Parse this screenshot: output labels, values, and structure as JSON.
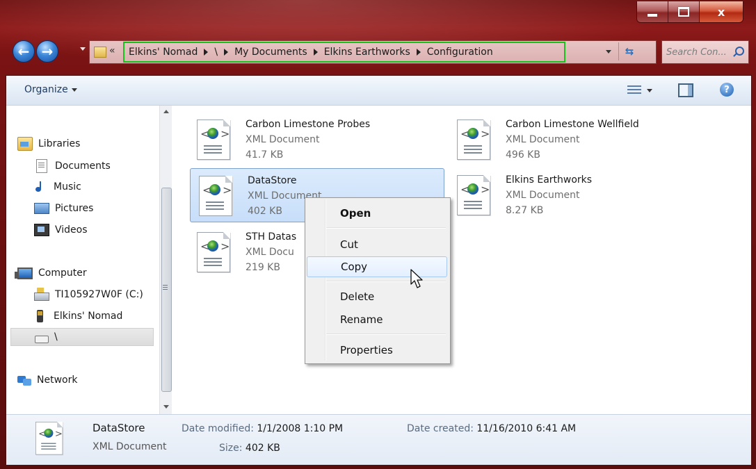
{
  "window": {
    "close_glyph": "x"
  },
  "nav": {
    "back_glyph": "←",
    "forward_glyph": "→",
    "overflow_chevrons": "«",
    "breadcrumbs": [
      "Elkins' Nomad",
      "\\",
      "My Documents",
      "Elkins Earthworks",
      "Configuration"
    ],
    "refresh_glyph": "⇆",
    "search_placeholder": "Search Con...",
    "path_highlight_color": "#19c21a"
  },
  "toolbar": {
    "organize_label": "Organize",
    "help_glyph": "?"
  },
  "sidebar": {
    "items": [
      {
        "label": "Libraries",
        "icon": "libraries-icon"
      },
      {
        "label": "Documents",
        "icon": "documents-icon"
      },
      {
        "label": "Music",
        "icon": "music-icon"
      },
      {
        "label": "Pictures",
        "icon": "pictures-icon"
      },
      {
        "label": "Videos",
        "icon": "videos-icon"
      },
      {
        "label": "Computer",
        "icon": "computer-icon"
      },
      {
        "label": "TI105927W0F (C:)",
        "icon": "drive-icon"
      },
      {
        "label": "Elkins' Nomad",
        "icon": "device-icon"
      },
      {
        "label": "\\",
        "icon": "removable-drive-icon"
      },
      {
        "label": "Network",
        "icon": "network-icon"
      }
    ]
  },
  "files": [
    {
      "name": "Carbon Limestone Probes",
      "type": "XML Document",
      "size": "41.7 KB"
    },
    {
      "name": "Carbon Limestone Wellfield",
      "type": "XML Document",
      "size": "496 KB"
    },
    {
      "name": "DataStore",
      "type": "XML Document",
      "size": "402 KB",
      "selected": true
    },
    {
      "name": "Elkins Earthworks",
      "type": "XML Document",
      "size": "8.27 KB"
    },
    {
      "name": "STH Datas",
      "type": "XML Docu",
      "size": "219 KB"
    }
  ],
  "context_menu": {
    "items": [
      "Open",
      "Cut",
      "Copy",
      "Delete",
      "Rename",
      "Properties"
    ],
    "hovered": "Copy"
  },
  "details": {
    "name": "DataStore",
    "type": "XML Document",
    "modified_label": "Date modified:",
    "modified_value": "1/1/2008 1:10 PM",
    "size_label": "Size:",
    "size_value": "402 KB",
    "created_label": "Date created:",
    "created_value": "11/16/2010 6:41 AM"
  }
}
